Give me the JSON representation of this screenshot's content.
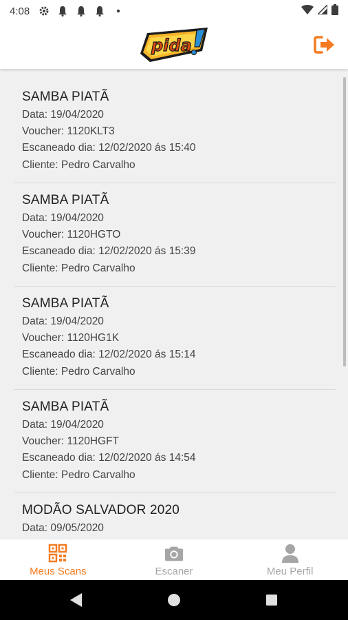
{
  "status_bar": {
    "time": "4:08",
    "icons_left": [
      "gear-icon",
      "bell-icon",
      "bell-icon",
      "bell-icon",
      "dot-icon"
    ],
    "icons_right": [
      "wifi-icon",
      "signal-icon",
      "battery-icon"
    ]
  },
  "header": {
    "logo_text": "Pida!",
    "logout_icon": "logout-icon",
    "accent_color": "#f47b20"
  },
  "scans": [
    {
      "title": "SAMBA PIATÃ",
      "date": "Data: 19/04/2020",
      "voucher": "Voucher: 1120KLT3",
      "scanned": "Escaneado dia: 12/02/2020 ás 15:40",
      "client": "Cliente: Pedro Carvalho"
    },
    {
      "title": "SAMBA PIATÃ",
      "date": "Data: 19/04/2020",
      "voucher": "Voucher: 1120HGTO",
      "scanned": "Escaneado dia: 12/02/2020 ás 15:39",
      "client": "Cliente: Pedro Carvalho"
    },
    {
      "title": "SAMBA PIATÃ",
      "date": "Data: 19/04/2020",
      "voucher": "Voucher: 1120HG1K",
      "scanned": "Escaneado dia: 12/02/2020 ás 15:14",
      "client": "Cliente: Pedro Carvalho"
    },
    {
      "title": "SAMBA PIATÃ",
      "date": "Data: 19/04/2020",
      "voucher": "Voucher: 1120HGFT",
      "scanned": "Escaneado dia: 12/02/2020 ás 14:54",
      "client": "Cliente: Pedro Carvalho"
    },
    {
      "title": "MODÃO SALVADOR 2020",
      "date": "Data: 09/05/2020",
      "voucher": "",
      "scanned": "",
      "client": ""
    }
  ],
  "bottom_nav": {
    "active_tab": "Meus Scans",
    "items": [
      {
        "label": "Meus Scans",
        "icon": "qr-code-icon"
      },
      {
        "label": "Escaner",
        "icon": "camera-icon"
      },
      {
        "label": "Meu Perfil",
        "icon": "person-icon"
      }
    ]
  },
  "system_nav": {
    "buttons": [
      "back-icon",
      "home-icon",
      "recents-icon"
    ]
  }
}
